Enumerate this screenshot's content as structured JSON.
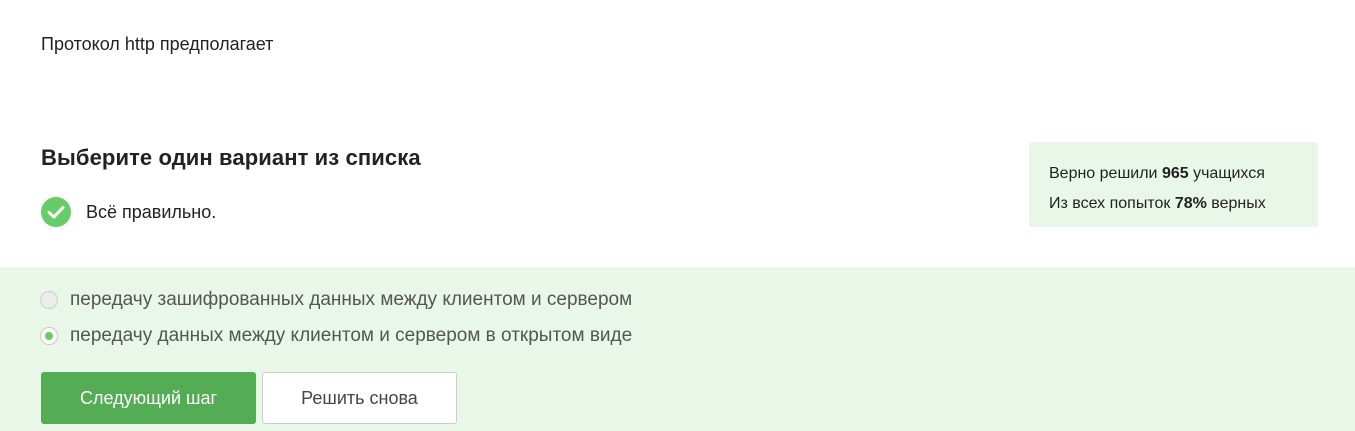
{
  "question": {
    "text": "Протокол http предполагает"
  },
  "instructions": {
    "title": "Выберите один вариант из списка"
  },
  "feedback": {
    "icon": "check-circle-icon",
    "text": "Всё правильно."
  },
  "stats": {
    "line1_prefix": "Верно решили ",
    "line1_count": "965",
    "line1_suffix": " учащихся",
    "line2_prefix": "Из всех попыток ",
    "line2_percent": "78%",
    "line2_suffix": " верных"
  },
  "options": [
    {
      "label": "передачу зашифрованных данных между клиентом и сервером",
      "selected": false
    },
    {
      "label": "передачу данных между клиентом и сервером в открытом виде",
      "selected": true
    }
  ],
  "buttons": {
    "next_label": "Следующий шаг",
    "retry_label": "Решить снова"
  },
  "colors": {
    "accent_green": "#54ad54",
    "check_green": "#66cc66",
    "answer_background": "#e9f7e9"
  }
}
